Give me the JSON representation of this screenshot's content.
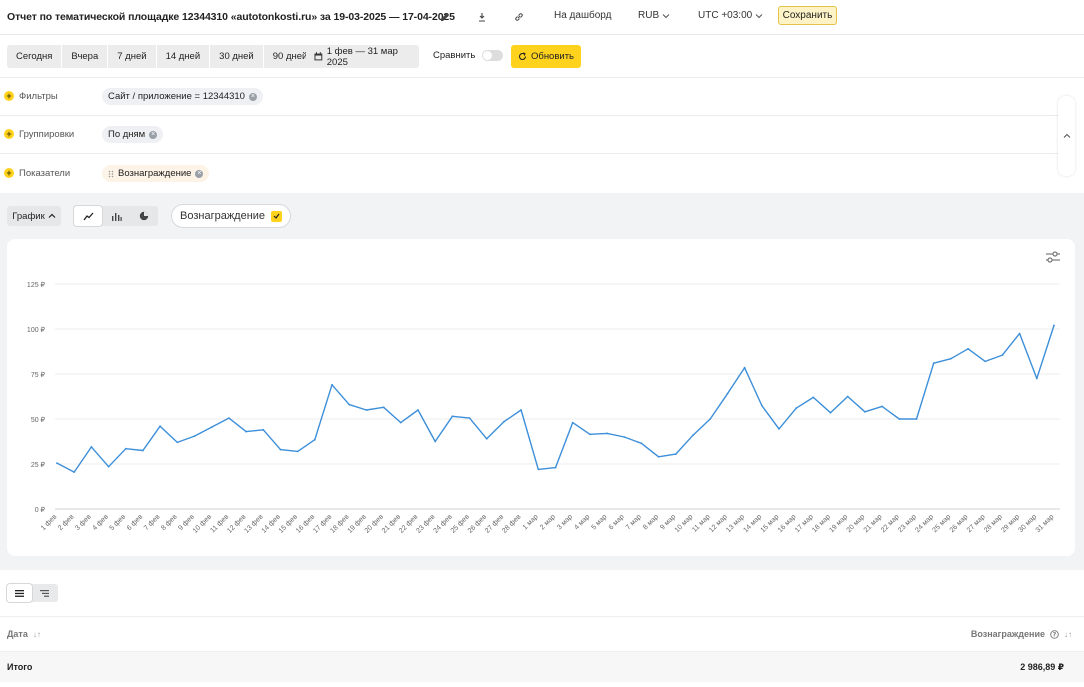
{
  "header": {
    "title": "Отчет по тематической площадке 12344310 «autotonkosti.ru» за 19-03-2025 — 17-04-2025",
    "dashboard_link": "На дашборд",
    "currency": "RUB",
    "timezone": "UTC +03:00",
    "save_label": "Сохранить"
  },
  "toolbar": {
    "periods": [
      "Сегодня",
      "Вчера",
      "7 дней",
      "14 дней",
      "30 дней",
      "90 дней"
    ],
    "date_range": "1 фев — 31 мар 2025",
    "compare_label": "Сравнить",
    "refresh_label": "Обновить"
  },
  "params": {
    "filters_label": "Фильтры",
    "filter_chip": "Сайт / приложение = 12344310",
    "groupings_label": "Группировки",
    "grouping_chip": "По дням",
    "metrics_label": "Показатели",
    "metric_chip": "Вознаграждение"
  },
  "chart_controls": {
    "type_label": "График",
    "metric_toggle": "Вознаграждение"
  },
  "colors": {
    "line": "#3d8fd9",
    "accent_yellow": "#ffd21e"
  },
  "chart_data": {
    "type": "line",
    "categories": [
      "1 фев",
      "2 фев",
      "3 фев",
      "4 фев",
      "5 фев",
      "6 фев",
      "7 фев",
      "8 фев",
      "9 фев",
      "10 фев",
      "11 фев",
      "12 фев",
      "13 фев",
      "14 фев",
      "15 фев",
      "16 фев",
      "17 фев",
      "18 фев",
      "19 фев",
      "20 фев",
      "21 фев",
      "22 фев",
      "23 фев",
      "24 фев",
      "25 фев",
      "26 фев",
      "27 фев",
      "28 фев",
      "1 мар",
      "2 мар",
      "3 мар",
      "4 мар",
      "5 мар",
      "6 мар",
      "7 мар",
      "8 мар",
      "9 мар",
      "10 мар",
      "11 мар",
      "12 мар",
      "13 мар",
      "14 мар",
      "15 мар",
      "16 мар",
      "17 мар",
      "18 мар",
      "19 мар",
      "20 мар",
      "21 мар",
      "22 мар",
      "23 мар",
      "24 мар",
      "25 мар",
      "26 мар",
      "27 мар",
      "28 мар",
      "29 мар",
      "30 мар",
      "31 мар"
    ],
    "series": [
      {
        "values": [
          25.5,
          20.5,
          34.5,
          23.5,
          33.5,
          32.5,
          46,
          37,
          40.5,
          45.5,
          50.5,
          43,
          44,
          33,
          32,
          38.5,
          69,
          58,
          55,
          56.5,
          48,
          55,
          37.5,
          51.5,
          50.5,
          39,
          48.5,
          55,
          22,
          23,
          48,
          41.5,
          42,
          40,
          36.5,
          29,
          30.5,
          41,
          50,
          64,
          78.5,
          57.5,
          44.5,
          56,
          62,
          53.5,
          62.5,
          54,
          57,
          50,
          50,
          81,
          83.5,
          89,
          82,
          85.5,
          97.5,
          72.5,
          102
        ]
      }
    ],
    "y_ticks": [
      "0 ₽",
      "25 ₽",
      "50 ₽",
      "75 ₽",
      "100 ₽",
      "125 ₽"
    ],
    "ylim": [
      0,
      125
    ],
    "grid": true
  },
  "table": {
    "col_date": "Дата",
    "col_reward": "Вознаграждение",
    "total_label": "Итого",
    "total_value": "2 986,89 ₽"
  }
}
